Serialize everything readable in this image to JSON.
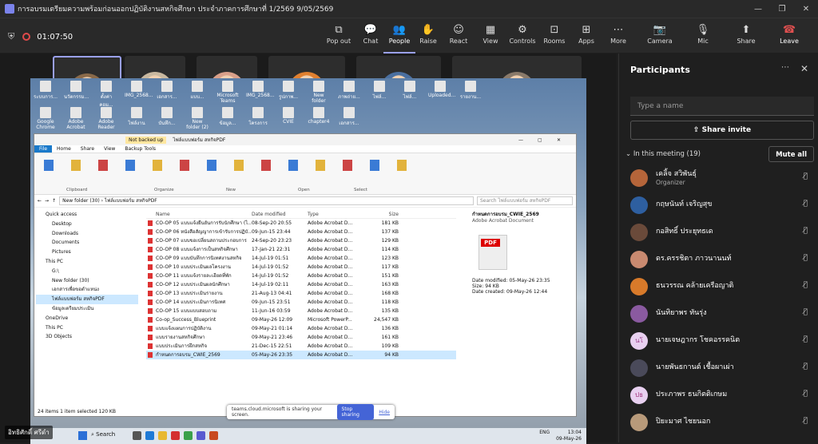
{
  "window": {
    "title": "การอบรมเตรียมความพร้อมก่อนออกปฏิบัติงานสหกิจศึกษา ประจำภาคการศึกษาที่ 1/2569 9/05/2569"
  },
  "toolbar": {
    "timer": "01:07:50",
    "items": [
      {
        "label": "Pop out",
        "icon": "popout-icon",
        "glyph": "⧉"
      },
      {
        "label": "Chat",
        "icon": "chat-icon",
        "glyph": "💬"
      },
      {
        "label": "People",
        "icon": "people-icon",
        "glyph": "👥",
        "badge": "19"
      },
      {
        "label": "Raise",
        "icon": "hand-icon",
        "glyph": "✋"
      },
      {
        "label": "React",
        "icon": "smile-icon",
        "glyph": "☺"
      },
      {
        "label": "View",
        "icon": "view-icon",
        "glyph": "▦"
      },
      {
        "label": "Controls",
        "icon": "controls-icon",
        "glyph": "⚙"
      },
      {
        "label": "Rooms",
        "icon": "rooms-icon",
        "glyph": "⊡"
      },
      {
        "label": "Apps",
        "icon": "apps-icon",
        "glyph": "⊞"
      },
      {
        "label": "More",
        "icon": "more-icon",
        "glyph": "⋯"
      },
      {
        "label": "Camera",
        "icon": "camera-icon",
        "glyph": "📷"
      },
      {
        "label": "Mic",
        "icon": "mic-off-icon",
        "glyph": "🎙"
      },
      {
        "label": "Share",
        "icon": "share-icon",
        "glyph": "⬆"
      }
    ],
    "leave": "Leave"
  },
  "thumbnails": [
    {
      "name": "อิทธิศักดิ์ ศรีดำ",
      "color": "#8a6a4a"
    },
    {
      "name": "ปิยะมาศ ไช...",
      "color": "#c9b8a0"
    },
    {
      "name": "ดร.ครรชิตา ...",
      "color": "#d9a08a"
    },
    {
      "name": "ธนวรรณ คล้...",
      "color": "#e08030"
    },
    {
      "name": "กฤษนันท์ เจ...",
      "color": "#4a6fa0"
    },
    {
      "name": "",
      "color": "#8a7a6a"
    }
  ],
  "share": {
    "desktop_row1": [
      "ระบบการ...",
      "นวัตกรรม...",
      "ตั้งค่าคอม...",
      "IMG_2568...",
      "เอกสาร...",
      "แบบ...",
      "Microsoft Teams",
      "IMG_2568...",
      "รูปภาพ...",
      "New folder",
      "ภาพถ่าย...",
      "ไฟล์...",
      "ไฟล์...",
      "Uploaded...",
      "รายงาน..."
    ],
    "desktop_row2": [
      "Google Chrome",
      "Adobe Acrobat",
      "Adobe Reader",
      "ไฟล์งาน",
      "บันทึก...",
      "New folder (2)",
      "ข้อมูล...",
      "โครงการ",
      "CVIE",
      "chapter4",
      "เอกสาร..."
    ],
    "explorer": {
      "title": "ไฟล์แบบฟอร์ม สหกิจPDF",
      "notice": "Not backed up",
      "tabs": [
        "File",
        "Home",
        "Share",
        "View",
        "Backup Tools"
      ],
      "groups": [
        "Clipboard",
        "Organize",
        "New",
        "Open",
        "Select"
      ],
      "address": "New folder (30)  ›  ไฟล์แบบฟอร์ม สหกิจPDF",
      "search": "Search ไฟล์แบบฟอร์ม สหกิจPDF",
      "nav": [
        "Quick access",
        "Desktop",
        "Downloads",
        "Documents",
        "Pictures",
        "This PC",
        "G:\\",
        "New folder (30)",
        "เอกสารเพื่อขอตำแหน่ง",
        "ไฟล์แบบฟอร์ม สหกิจPDF",
        "ข้อมูลเตรียมประเมิน",
        "OneDrive",
        "This PC",
        "3D Objects"
      ],
      "headers": [
        "Name",
        "Date modified",
        "Type",
        "Size"
      ],
      "files": [
        [
          "CO-OP 05 แบบแจ้งยืนยันการรับนักศึกษา (ไ...",
          "08-Sep-20 20:55",
          "Adobe Acrobat D...",
          "181 KB"
        ],
        [
          "CO-OP 06 หนังสือสัญญาการเข้ารับการปฏิบั...",
          "09-Jun-15 23:44",
          "Adobe Acrobat D...",
          "137 KB"
        ],
        [
          "CO-OP 07 แบบขอเปลี่ยนสถานประกอบการ",
          "24-Sep-20 23:23",
          "Adobe Acrobat D...",
          "129 KB"
        ],
        [
          "CO-OP 08 แบบแจ้งการเป็นสหกิจศึกษา",
          "17-Jan-21 22:31",
          "Adobe Acrobat D...",
          "114 KB"
        ],
        [
          "CO-OP 09 แบบบันทึกการนิเทศงานสหกิจ",
          "14-Jul-19 01:51",
          "Adobe Acrobat D...",
          "123 KB"
        ],
        [
          "CO-OP 10 แบบประเมินผลโครงงาน",
          "14-Jul-19 01:52",
          "Adobe Acrobat D...",
          "117 KB"
        ],
        [
          "CO-OP 11 แบบแจ้งรายละเอียดที่พัก",
          "14-Jul-19 01:52",
          "Adobe Acrobat D...",
          "151 KB"
        ],
        [
          "CO-OP 12 แบบประเมินผลนักศึกษา",
          "14-Jul-19 02:11",
          "Adobe Acrobat D...",
          "163 KB"
        ],
        [
          "CO-OP 13 แบบประเมินรายงาน",
          "21-Aug-13 04:41",
          "Adobe Acrobat D...",
          "168 KB"
        ],
        [
          "CO-OP 14 แบบประเมินการนิเทศ",
          "09-Jun-15 23:51",
          "Adobe Acrobat D...",
          "118 KB"
        ],
        [
          "CO-OP 15 แบบแบบสอบถาม",
          "11-Jun-16 03:59",
          "Adobe Acrobat D...",
          "135 KB"
        ],
        [
          "Co-op_Success_Blueprint",
          "09-May-26 12:09",
          "Microsoft PowerP...",
          "24,547 KB"
        ],
        [
          "แบบแจ้งแผนการปฏิบัติงาน",
          "09-May-21 01:14",
          "Adobe Acrobat D...",
          "136 KB"
        ],
        [
          "แบบรายงานสหกิจศึกษา",
          "09-May-21 23:46",
          "Adobe Acrobat D...",
          "161 KB"
        ],
        [
          "แบบประเมินการฝึกสหกิจ",
          "21-Dec-15 22:51",
          "Adobe Acrobat D...",
          "109 KB"
        ],
        [
          "กำหนดการอบรม_CWIE_2569",
          "05-May-26 23:35",
          "Adobe Acrobat D...",
          "94 KB"
        ]
      ],
      "preview": {
        "name": "กำหนดการอบรม_CWIE_2569",
        "type": "Adobe Acrobat Document",
        "badge": "PDF",
        "modified_label": "Date modified:",
        "modified": "05-May-26 23:35",
        "size_label": "Size:",
        "size": "94 KB",
        "created_label": "Date created:",
        "created": "09-May-26 12:44"
      },
      "status": "24 items    1 item selected  120 KB"
    },
    "sharebar": {
      "msg": "teams.cloud.microsoft is sharing your screen.",
      "stop": "Stop sharing",
      "hide": "Hide"
    },
    "taskbar": {
      "search": "Search",
      "lang": "ENG",
      "time": "13:04",
      "date": "09-May-26"
    },
    "speaker": "อิทธิศักดิ์ ศรีดำ"
  },
  "panel": {
    "title": "Participants",
    "search_placeholder": "Type a name",
    "invite": "Share invite",
    "section": "In this meeting (19)",
    "mute_all": "Mute all",
    "people": [
      {
        "name": "เคลิ้จ สวิพันธุ์",
        "role": "Organizer",
        "initials": "",
        "color": "#b5653a"
      },
      {
        "name": "กฤษนันท์ เจริญสุข",
        "role": "",
        "initials": "",
        "color": "#2e5fa0"
      },
      {
        "name": "กอสิทธิ์ ประยุทธเด",
        "role": "",
        "initials": "",
        "color": "#6a4a3a"
      },
      {
        "name": "ดร.ครรชิตา ภาวนานนท์",
        "role": "",
        "initials": "",
        "color": "#c98a70"
      },
      {
        "name": "ธนวรรณ คล้ายเครือญาติ",
        "role": "",
        "initials": "",
        "color": "#d87a2a"
      },
      {
        "name": "นันทิยาพร ทันรุ่ง",
        "role": "",
        "initials": "",
        "color": "#8a5aa0"
      },
      {
        "name": "นายเจษฎากร โชคอรรคนิต",
        "role": "",
        "initials": "นโ",
        "color": "#9b3b8a"
      },
      {
        "name": "นายพันธกานต์ เชื้อผาเผ่า",
        "role": "",
        "initials": "",
        "color": "#4a4a5a"
      },
      {
        "name": "ประภาพร ธนกิตติเกษม",
        "role": "",
        "initials": "ปธ",
        "color": "#a0307a"
      },
      {
        "name": "ปิยะมาศ ไชยนอก",
        "role": "",
        "initials": "",
        "color": "#b89a7a"
      }
    ]
  }
}
